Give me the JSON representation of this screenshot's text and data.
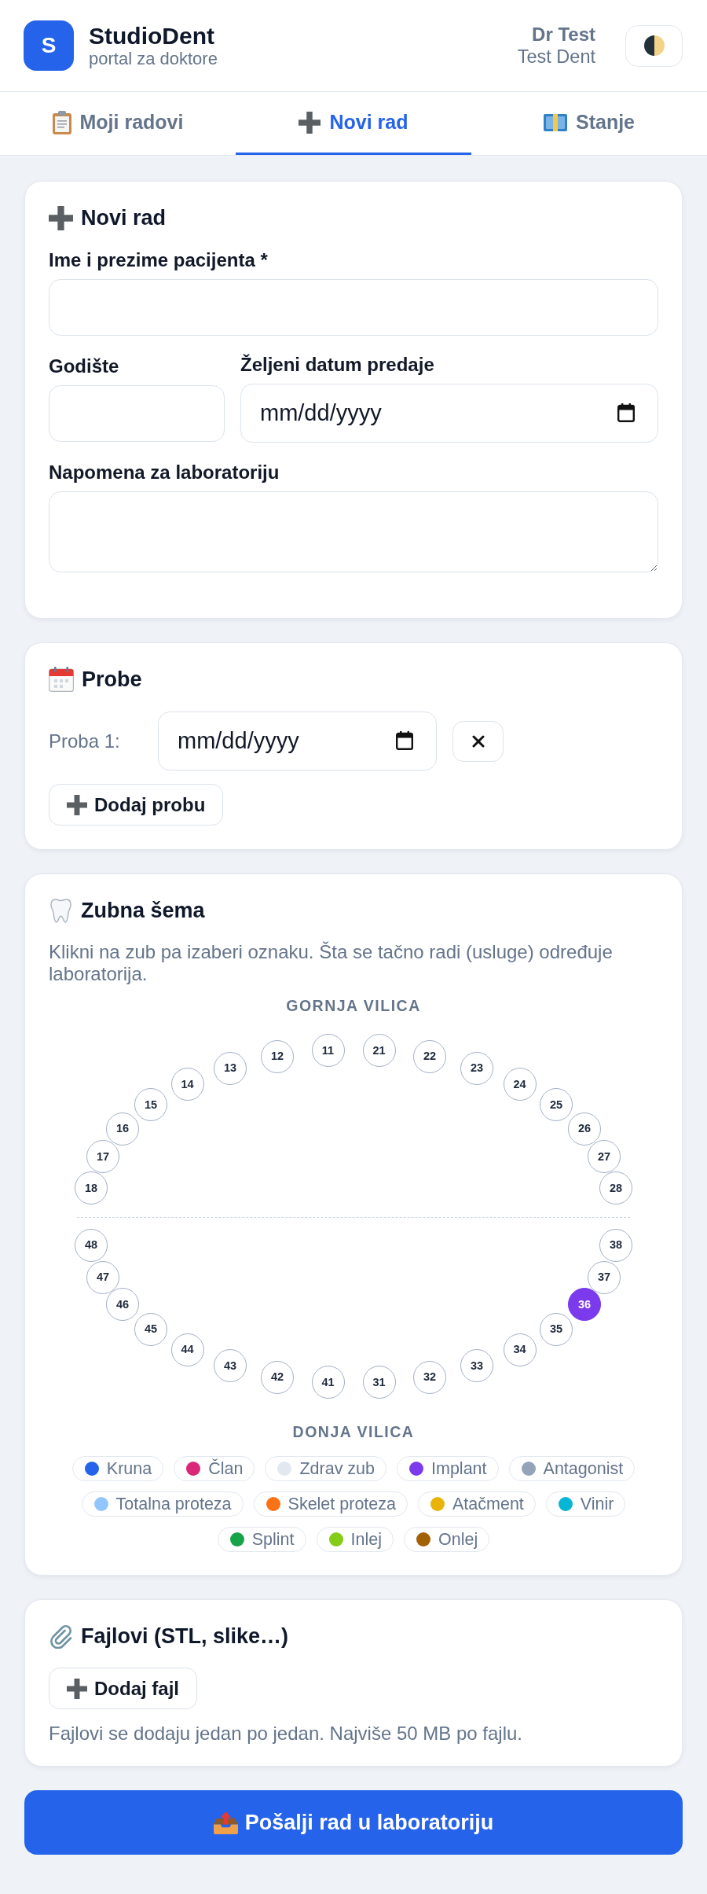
{
  "header": {
    "logo_letter": "S",
    "app_name": "StudioDent",
    "subtitle": "portal za doktore",
    "user_name": "Dr Test",
    "clinic_name": "Test Dent"
  },
  "tabs": [
    {
      "label": "Moji radovi",
      "selected": false
    },
    {
      "label": "Novi rad",
      "selected": true
    },
    {
      "label": "Stanje",
      "selected": false
    }
  ],
  "new_work": {
    "title": "Novi rad",
    "patient_name": {
      "label": "Ime i prezime pacijenta *"
    },
    "birth_year": {
      "label": "Godište"
    },
    "due_date": {
      "label": "Željeni datum predaje",
      "placeholder": "mm/dd/yyyy"
    },
    "note": {
      "label": "Napomena za laboratoriju"
    }
  },
  "trials": {
    "title": "Probe",
    "items": [
      {
        "label": "Proba 1:",
        "placeholder": "mm/dd/yyyy"
      }
    ],
    "add_button": "Dodaj probu"
  },
  "tooth_chart": {
    "title": "Zubna šema",
    "description": "Klikni na zub pa izaberi oznaku. Šta se tačno radi (usluge) određuje laboratorija.",
    "upper_jaw": {
      "label": "GORNJA VILICA",
      "teeth": [
        {
          "label": "18",
          "marked": false
        },
        {
          "label": "17",
          "marked": false
        },
        {
          "label": "16",
          "marked": false
        },
        {
          "label": "15",
          "marked": false
        },
        {
          "label": "14",
          "marked": false
        },
        {
          "label": "13",
          "marked": false
        },
        {
          "label": "12",
          "marked": false
        },
        {
          "label": "11",
          "marked": false
        },
        {
          "label": "21",
          "marked": false
        },
        {
          "label": "22",
          "marked": false
        },
        {
          "label": "23",
          "marked": false
        },
        {
          "label": "24",
          "marked": false
        },
        {
          "label": "25",
          "marked": false
        },
        {
          "label": "26",
          "marked": false
        },
        {
          "label": "27",
          "marked": false
        },
        {
          "label": "28",
          "marked": false
        }
      ]
    },
    "lower_jaw": {
      "teeth": [
        {
          "label": "48",
          "marked": false
        },
        {
          "label": "47",
          "marked": false
        },
        {
          "label": "46",
          "marked": false
        },
        {
          "label": "45",
          "marked": false
        },
        {
          "label": "44",
          "marked": false
        },
        {
          "label": "43",
          "marked": false
        },
        {
          "label": "42",
          "marked": false
        },
        {
          "label": "41",
          "marked": false
        },
        {
          "label": "31",
          "marked": false
        },
        {
          "label": "32",
          "marked": false
        },
        {
          "label": "33",
          "marked": false
        },
        {
          "label": "34",
          "marked": false
        },
        {
          "label": "35",
          "marked": false
        },
        {
          "label": "36",
          "marked": true,
          "color": "#7c3aed"
        },
        {
          "label": "37",
          "marked": false
        },
        {
          "label": "38",
          "marked": false
        }
      ],
      "label": "DONJA VILICA"
    },
    "legend": [
      {
        "label": "Kruna",
        "color": "#2563eb"
      },
      {
        "label": "Član",
        "color": "#db2777"
      },
      {
        "label": "Zdrav zub",
        "color": "#e2e8f0"
      },
      {
        "label": "Implant",
        "color": "#7c3aed"
      },
      {
        "label": "Antagonist",
        "color": "#94a3b8"
      },
      {
        "label": "Totalna proteza",
        "color": "#93c5fd"
      },
      {
        "label": "Skelet proteza",
        "color": "#f97316"
      },
      {
        "label": "Atačment",
        "color": "#eab308"
      },
      {
        "label": "Vinir",
        "color": "#06b6d4"
      },
      {
        "label": "Splint",
        "color": "#16a34a"
      },
      {
        "label": "Inlej",
        "color": "#84cc16"
      },
      {
        "label": "Onlej",
        "color": "#a16207"
      }
    ]
  },
  "files": {
    "title": "Fajlovi (STL, slike…)",
    "add_button": "Dodaj fajl",
    "note": "Fajlovi se dodaju jedan po jedan. Najviše 50 MB po fajlu."
  },
  "submit_button": "Pošalji rad u laboratoriju"
}
